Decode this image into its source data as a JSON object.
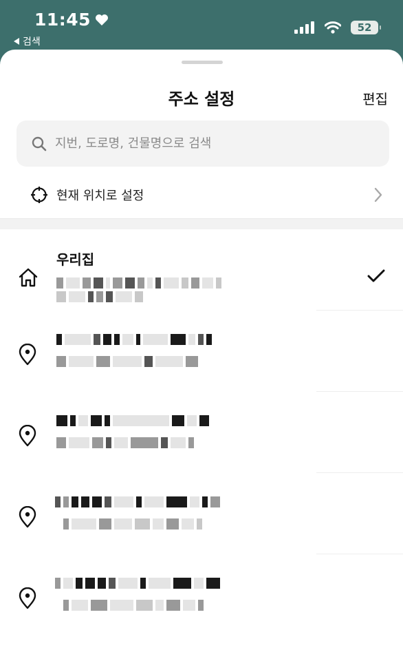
{
  "status_bar": {
    "time": "11:45",
    "back_app": "검색",
    "battery_level": "52",
    "icons": [
      "heart-icon",
      "signal-icon",
      "wifi-icon",
      "battery-icon"
    ]
  },
  "sheet": {
    "title": "주소 설정",
    "edit_label": "편집",
    "search": {
      "placeholder": "지번, 도로명, 건물명으로 검색",
      "value": ""
    },
    "current_location_label": "현재 위치로 설정"
  },
  "addresses": [
    {
      "name": "우리집",
      "icon": "home-icon",
      "selected": true
    },
    {
      "name": "",
      "icon": "location-pin-icon",
      "selected": false
    },
    {
      "name": "",
      "icon": "location-pin-icon",
      "selected": false
    },
    {
      "name": "",
      "icon": "location-pin-icon",
      "selected": false
    },
    {
      "name": "",
      "icon": "location-pin-icon",
      "selected": false
    }
  ],
  "colors": {
    "status_bar": "#3d6f6c",
    "sheet": "#ffffff",
    "search_bg": "#f3f3f3"
  }
}
